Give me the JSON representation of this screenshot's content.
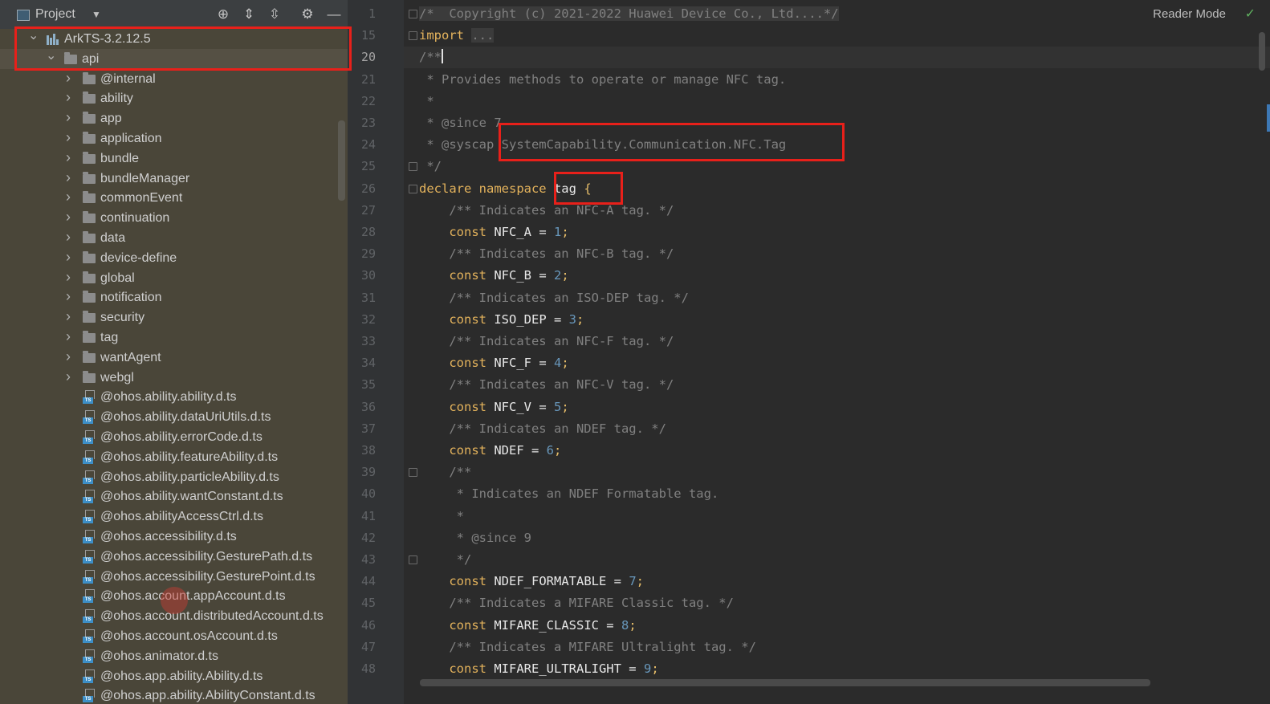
{
  "panel": {
    "title": "Project",
    "header_buttons": [
      {
        "name": "locate-icon",
        "glyph": "⊕"
      },
      {
        "name": "expand-all-icon",
        "glyph": "⇕"
      },
      {
        "name": "collapse-all-icon",
        "glyph": "⇳"
      },
      {
        "name": "gear-icon",
        "glyph": "⚙"
      },
      {
        "name": "minimize-icon",
        "glyph": "—"
      }
    ],
    "tree": [
      {
        "label": "ArkTS-3.2.12.5",
        "kind": "library",
        "depth": 0,
        "expanded": true
      },
      {
        "label": "api",
        "kind": "folder",
        "depth": 1,
        "expanded": true,
        "selected": true
      },
      {
        "label": "@internal",
        "kind": "folder",
        "depth": 2
      },
      {
        "label": "ability",
        "kind": "folder",
        "depth": 2
      },
      {
        "label": "app",
        "kind": "folder",
        "depth": 2
      },
      {
        "label": "application",
        "kind": "folder",
        "depth": 2
      },
      {
        "label": "bundle",
        "kind": "folder",
        "depth": 2
      },
      {
        "label": "bundleManager",
        "kind": "folder",
        "depth": 2
      },
      {
        "label": "commonEvent",
        "kind": "folder",
        "depth": 2
      },
      {
        "label": "continuation",
        "kind": "folder",
        "depth": 2
      },
      {
        "label": "data",
        "kind": "folder",
        "depth": 2
      },
      {
        "label": "device-define",
        "kind": "folder",
        "depth": 2
      },
      {
        "label": "global",
        "kind": "folder",
        "depth": 2
      },
      {
        "label": "notification",
        "kind": "folder",
        "depth": 2
      },
      {
        "label": "security",
        "kind": "folder",
        "depth": 2
      },
      {
        "label": "tag",
        "kind": "folder",
        "depth": 2
      },
      {
        "label": "wantAgent",
        "kind": "folder",
        "depth": 2
      },
      {
        "label": "webgl",
        "kind": "folder",
        "depth": 2
      },
      {
        "label": "@ohos.ability.ability.d.ts",
        "kind": "file",
        "depth": 2
      },
      {
        "label": "@ohos.ability.dataUriUtils.d.ts",
        "kind": "file",
        "depth": 2
      },
      {
        "label": "@ohos.ability.errorCode.d.ts",
        "kind": "file",
        "depth": 2
      },
      {
        "label": "@ohos.ability.featureAbility.d.ts",
        "kind": "file",
        "depth": 2
      },
      {
        "label": "@ohos.ability.particleAbility.d.ts",
        "kind": "file",
        "depth": 2
      },
      {
        "label": "@ohos.ability.wantConstant.d.ts",
        "kind": "file",
        "depth": 2
      },
      {
        "label": "@ohos.abilityAccessCtrl.d.ts",
        "kind": "file",
        "depth": 2
      },
      {
        "label": "@ohos.accessibility.d.ts",
        "kind": "file",
        "depth": 2
      },
      {
        "label": "@ohos.accessibility.GesturePath.d.ts",
        "kind": "file",
        "depth": 2
      },
      {
        "label": "@ohos.accessibility.GesturePoint.d.ts",
        "kind": "file",
        "depth": 2
      },
      {
        "label": "@ohos.account.appAccount.d.ts",
        "kind": "file",
        "depth": 2
      },
      {
        "label": "@ohos.account.distributedAccount.d.ts",
        "kind": "file",
        "depth": 2
      },
      {
        "label": "@ohos.account.osAccount.d.ts",
        "kind": "file",
        "depth": 2
      },
      {
        "label": "@ohos.animator.d.ts",
        "kind": "file",
        "depth": 2
      },
      {
        "label": "@ohos.app.ability.Ability.d.ts",
        "kind": "file",
        "depth": 2
      },
      {
        "label": "@ohos.app.ability.AbilityConstant.d.ts",
        "kind": "file",
        "depth": 2
      }
    ]
  },
  "editor": {
    "reader_mode_label": "Reader Mode",
    "current_line": "20",
    "lines": [
      {
        "no": "1",
        "fold": true,
        "tokens": [
          {
            "t": "/*  Copyright (c) 2021-2022 Huawei Device Co., Ltd....*/",
            "c": "fold-text"
          }
        ]
      },
      {
        "no": "15",
        "fold": true,
        "tokens": [
          {
            "t": "import",
            "c": "kw2"
          },
          {
            "t": " ",
            "c": ""
          },
          {
            "t": "...",
            "c": "fold-text"
          }
        ]
      },
      {
        "no": "20",
        "fold": true,
        "current": true,
        "tokens": [
          {
            "t": "/**",
            "c": "cmt"
          }
        ]
      },
      {
        "no": "21",
        "tokens": [
          {
            "t": " * Provides methods to operate or manage NFC tag.",
            "c": "cmt"
          }
        ]
      },
      {
        "no": "22",
        "tokens": [
          {
            "t": " *",
            "c": "cmt"
          }
        ]
      },
      {
        "no": "23",
        "tokens": [
          {
            "t": " * @since 7",
            "c": "cmt"
          }
        ]
      },
      {
        "no": "24",
        "tokens": [
          {
            "t": " * @syscap SystemCapability.Communication.NFC.Tag",
            "c": "cmt"
          }
        ]
      },
      {
        "no": "25",
        "fold": true,
        "tokens": [
          {
            "t": " */",
            "c": "cmt"
          }
        ]
      },
      {
        "no": "26",
        "fold": true,
        "tokens": [
          {
            "t": "declare namespace",
            "c": "kw2"
          },
          {
            "t": " tag ",
            "c": "ident"
          },
          {
            "t": "{",
            "c": "brace"
          }
        ]
      },
      {
        "no": "27",
        "tokens": [
          {
            "t": "    /** Indicates an NFC-A tag. */",
            "c": "cmt"
          }
        ]
      },
      {
        "no": "28",
        "tokens": [
          {
            "t": "    const",
            "c": "kw2"
          },
          {
            "t": " NFC_A = ",
            "c": "ident"
          },
          {
            "t": "1",
            "c": "num"
          },
          {
            "t": ";",
            "c": "brace"
          }
        ]
      },
      {
        "no": "29",
        "tokens": [
          {
            "t": "    /** Indicates an NFC-B tag. */",
            "c": "cmt"
          }
        ]
      },
      {
        "no": "30",
        "tokens": [
          {
            "t": "    const",
            "c": "kw2"
          },
          {
            "t": " NFC_B = ",
            "c": "ident"
          },
          {
            "t": "2",
            "c": "num"
          },
          {
            "t": ";",
            "c": "brace"
          }
        ]
      },
      {
        "no": "31",
        "tokens": [
          {
            "t": "    /** Indicates an ISO-DEP tag. */",
            "c": "cmt"
          }
        ]
      },
      {
        "no": "32",
        "tokens": [
          {
            "t": "    const",
            "c": "kw2"
          },
          {
            "t": " ISO_DEP = ",
            "c": "ident"
          },
          {
            "t": "3",
            "c": "num"
          },
          {
            "t": ";",
            "c": "brace"
          }
        ]
      },
      {
        "no": "33",
        "tokens": [
          {
            "t": "    /** Indicates an NFC-F tag. */",
            "c": "cmt"
          }
        ]
      },
      {
        "no": "34",
        "tokens": [
          {
            "t": "    const",
            "c": "kw2"
          },
          {
            "t": " NFC_F = ",
            "c": "ident"
          },
          {
            "t": "4",
            "c": "num"
          },
          {
            "t": ";",
            "c": "brace"
          }
        ]
      },
      {
        "no": "35",
        "tokens": [
          {
            "t": "    /** Indicates an NFC-V tag. */",
            "c": "cmt"
          }
        ]
      },
      {
        "no": "36",
        "tokens": [
          {
            "t": "    const",
            "c": "kw2"
          },
          {
            "t": " NFC_V = ",
            "c": "ident"
          },
          {
            "t": "5",
            "c": "num"
          },
          {
            "t": ";",
            "c": "brace"
          }
        ]
      },
      {
        "no": "37",
        "tokens": [
          {
            "t": "    /** Indicates an NDEF tag. */",
            "c": "cmt"
          }
        ]
      },
      {
        "no": "38",
        "tokens": [
          {
            "t": "    const",
            "c": "kw2"
          },
          {
            "t": " NDEF = ",
            "c": "ident"
          },
          {
            "t": "6",
            "c": "num"
          },
          {
            "t": ";",
            "c": "brace"
          }
        ]
      },
      {
        "no": "39",
        "fold": true,
        "tokens": [
          {
            "t": "    /**",
            "c": "cmt"
          }
        ]
      },
      {
        "no": "40",
        "tokens": [
          {
            "t": "     * Indicates an NDEF Formatable tag.",
            "c": "cmt"
          }
        ]
      },
      {
        "no": "41",
        "tokens": [
          {
            "t": "     *",
            "c": "cmt"
          }
        ]
      },
      {
        "no": "42",
        "tokens": [
          {
            "t": "     * @since 9",
            "c": "cmt"
          }
        ]
      },
      {
        "no": "43",
        "fold": true,
        "tokens": [
          {
            "t": "     */",
            "c": "cmt"
          }
        ]
      },
      {
        "no": "44",
        "tokens": [
          {
            "t": "    const",
            "c": "kw2"
          },
          {
            "t": " NDEF_FORMATABLE = ",
            "c": "ident"
          },
          {
            "t": "7",
            "c": "num"
          },
          {
            "t": ";",
            "c": "brace"
          }
        ]
      },
      {
        "no": "45",
        "tokens": [
          {
            "t": "    /** Indicates a MIFARE Classic tag. */",
            "c": "cmt"
          }
        ]
      },
      {
        "no": "46",
        "tokens": [
          {
            "t": "    const",
            "c": "kw2"
          },
          {
            "t": " MIFARE_CLASSIC = ",
            "c": "ident"
          },
          {
            "t": "8",
            "c": "num"
          },
          {
            "t": ";",
            "c": "brace"
          }
        ]
      },
      {
        "no": "47",
        "tokens": [
          {
            "t": "    /** Indicates a MIFARE Ultralight tag. */",
            "c": "cmt"
          }
        ]
      },
      {
        "no": "48",
        "tokens": [
          {
            "t": "    const",
            "c": "kw2"
          },
          {
            "t": " MIFARE_ULTRALIGHT = ",
            "c": "ident"
          },
          {
            "t": "9",
            "c": "num"
          },
          {
            "t": ";",
            "c": "brace"
          }
        ]
      }
    ]
  },
  "colors": {
    "annotation_red": "#e8201a",
    "panel_bg": "#4a4639",
    "editor_bg": "#2b2b2b"
  }
}
